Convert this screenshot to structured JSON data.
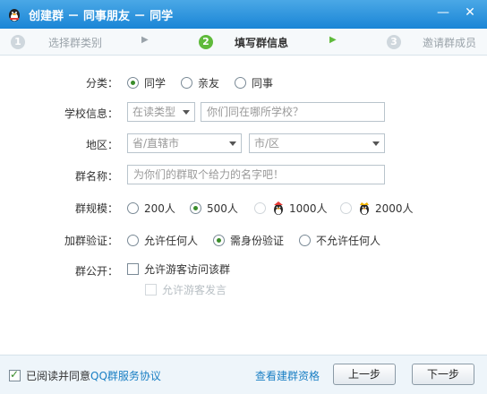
{
  "window": {
    "title": "创建群 － 同事朋友 － 同学",
    "min_glyph": "—",
    "close_glyph": "✕"
  },
  "steps": [
    {
      "num": "1",
      "label": "选择群类别"
    },
    {
      "num": "2",
      "label": "填写群信息"
    },
    {
      "num": "3",
      "label": "邀请群成员"
    }
  ],
  "category": {
    "label": "分类：",
    "options": [
      "同学",
      "亲友",
      "同事"
    ],
    "selected": "同学"
  },
  "school": {
    "label": "学校信息：",
    "type_select": "在读类型",
    "school_placeholder": "你们同在哪所学校？"
  },
  "region": {
    "label": "地区：",
    "province": "省/直辖市",
    "city": "市/区"
  },
  "group_name": {
    "label": "群名称：",
    "placeholder": "为你们的群取个给力的名字吧！"
  },
  "group_size": {
    "label": "群规模：",
    "options": [
      "200人",
      "500人",
      "1000人",
      "2000人"
    ],
    "selected": "500人"
  },
  "verify": {
    "label": "加群验证：",
    "options": [
      "允许任何人",
      "需身份验证",
      "不允许任何人"
    ],
    "selected": "需身份验证"
  },
  "public": {
    "label": "群公开：",
    "allow_visit": "允许游客访问该群",
    "allow_speak": "允许游客发言"
  },
  "footer": {
    "agree_text": "已阅读并同意",
    "agree_link": "QQ群服务协议",
    "qualification_link": "查看建群资格",
    "prev_button": "上一步",
    "next_button": "下一步"
  },
  "colors": {
    "titlebar": "#1a85d6",
    "accent_green": "#5fba3b",
    "link": "#1a7fc4"
  }
}
